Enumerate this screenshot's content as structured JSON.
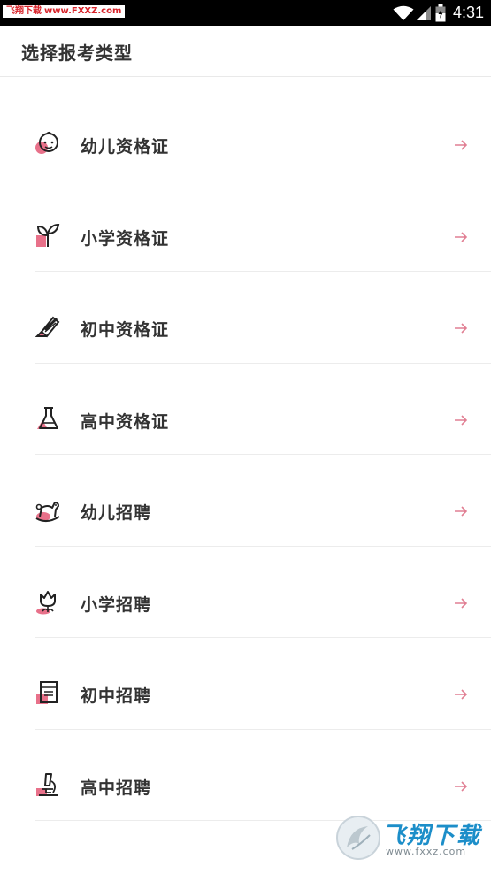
{
  "status_bar": {
    "watermark_cn": "飞翔下载",
    "watermark_url": "www.FXXZ.com",
    "time": "4:31",
    "icons": [
      "wifi-icon",
      "signal-icon",
      "battery-icon"
    ]
  },
  "header": {
    "title": "选择报考类型"
  },
  "items": [
    {
      "label": "幼儿资格证",
      "icon": "baby-face-icon"
    },
    {
      "label": "小学资格证",
      "icon": "sprout-icon"
    },
    {
      "label": "初中资格证",
      "icon": "marker-pen-icon"
    },
    {
      "label": "高中资格证",
      "icon": "flask-icon"
    },
    {
      "label": "幼儿招聘",
      "icon": "rocking-horse-icon"
    },
    {
      "label": "小学招聘",
      "icon": "tulip-icon"
    },
    {
      "label": "初中招聘",
      "icon": "book-icon"
    },
    {
      "label": "高中招聘",
      "icon": "microscope-icon"
    }
  ],
  "colors": {
    "accent_pink": "#e8718a",
    "arrow": "#e17f93",
    "text_dark": "#333333",
    "divider": "#ececec"
  },
  "watermark_bottom": {
    "brand": "飞翔下载",
    "url": "www.fxxz.com"
  }
}
